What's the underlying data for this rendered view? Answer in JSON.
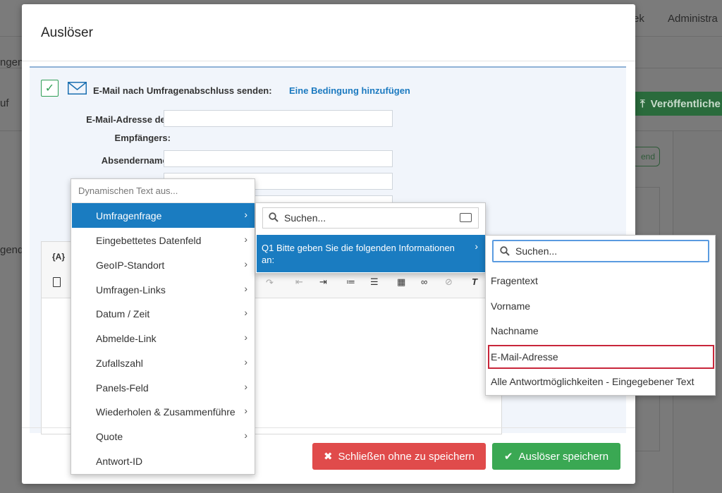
{
  "background": {
    "nav_items": [
      "ek",
      "Administra"
    ],
    "left_snippets": [
      "ngen",
      "uf",
      "gend"
    ],
    "publish_label": "Veröffentliche",
    "badge_label": "end"
  },
  "modal": {
    "title": "Auslöser",
    "email_label": "E-Mail nach Umfragenabschluss senden:",
    "add_condition": "Eine Bedingung hinzufügen",
    "recipient_label_1": "E-Mail-Adresse des",
    "recipient_label_2": "Empfängers:",
    "sender_name_label": "Absendername:",
    "editor_dynamic_text_btn": "{A}",
    "cancel_button": "Schließen ohne zu speichern",
    "save_button": "Auslöser speichern"
  },
  "dynamic_menu": {
    "header": "Dynamischen Text aus...",
    "items": [
      {
        "label": "Umfragenfrage",
        "active": true
      },
      {
        "label": "Eingebettetes Datenfeld"
      },
      {
        "label": "GeoIP-Standort"
      },
      {
        "label": "Umfragen-Links"
      },
      {
        "label": "Datum / Zeit"
      },
      {
        "label": "Abmelde-Link"
      },
      {
        "label": "Zufallszahl"
      },
      {
        "label": "Panels-Feld"
      },
      {
        "label": "Wiederholen & Zusammenführe"
      },
      {
        "label": "Quote"
      },
      {
        "label": "Antwort-ID"
      }
    ]
  },
  "question_menu": {
    "search_placeholder": "Suchen...",
    "item": "Q1 Bitte geben Sie die folgenden Informationen an:"
  },
  "field_menu": {
    "search_placeholder": "Suchen...",
    "items": [
      {
        "label": "Fragentext"
      },
      {
        "label": "Vorname"
      },
      {
        "label": "Nachname"
      },
      {
        "label": "E-Mail-Adresse",
        "highlighted": true
      },
      {
        "label": "Alle Antwortmöglichkeiten - Eingegebener Text"
      }
    ]
  },
  "colors": {
    "primary": "#1a7cc1",
    "success": "#3aa853",
    "danger": "#e04b4b",
    "highlight_border": "#c8263a"
  }
}
